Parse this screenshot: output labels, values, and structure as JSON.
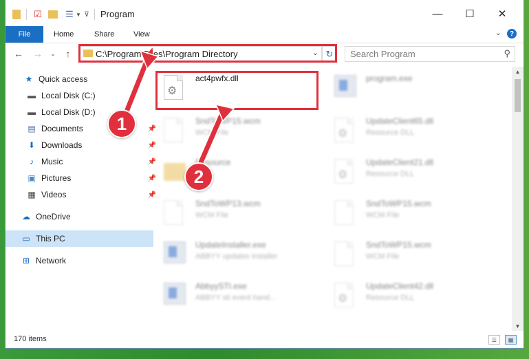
{
  "window": {
    "title": "Program",
    "controls": {
      "minimize": "—",
      "maximize": "☐",
      "close": "✕"
    }
  },
  "ribbon": {
    "tabs": [
      "File",
      "Home",
      "Share",
      "View"
    ],
    "help": "?"
  },
  "address": {
    "path": "C:\\Program Files\\Program Directory",
    "search_placeholder": "Search Program"
  },
  "nav": {
    "items": [
      {
        "label": "Quick access",
        "icon": "star-icon",
        "pinned": false
      },
      {
        "label": "Local Disk (C:)",
        "icon": "drive-icon",
        "pinned": false
      },
      {
        "label": "Local Disk (D:)",
        "icon": "drive-icon",
        "pinned": false
      },
      {
        "label": "Documents",
        "icon": "documents-icon",
        "pinned": true
      },
      {
        "label": "Downloads",
        "icon": "download-icon",
        "pinned": true
      },
      {
        "label": "Music",
        "icon": "music-icon",
        "pinned": true
      },
      {
        "label": "Pictures",
        "icon": "pictures-icon",
        "pinned": true
      },
      {
        "label": "Videos",
        "icon": "videos-icon",
        "pinned": true
      },
      {
        "label": "OneDrive",
        "icon": "cloud-icon",
        "pinned": false
      },
      {
        "label": "This PC",
        "icon": "computer-icon",
        "pinned": false,
        "selected": true
      },
      {
        "label": "Network",
        "icon": "network-icon",
        "pinned": false
      }
    ]
  },
  "files": [
    {
      "name": "act4pwfx.dll",
      "type": "",
      "icon": "dll-gear-icon",
      "highlighted": true
    },
    {
      "name": "program.exe",
      "type": "",
      "icon": "app-icon",
      "blurred": true
    },
    {
      "name": "SndToWP15.wcm",
      "type": "WCM File",
      "icon": "document-icon",
      "blurred": true
    },
    {
      "name": "UpdateClient65.dll",
      "type": "Resource DLL",
      "icon": "dll-gear-icon",
      "blurred": true
    },
    {
      "name": "Resource",
      "type": "",
      "icon": "folder-icon",
      "blurred": true
    },
    {
      "name": "UpdateClient21.dll",
      "type": "Resource DLL",
      "icon": "dll-gear-icon",
      "blurred": true
    },
    {
      "name": "SndToWP13.wcm",
      "type": "WCM File",
      "icon": "document-icon",
      "blurred": true
    },
    {
      "name": "SndToWP15.wcm",
      "type": "WCM File",
      "icon": "document-icon",
      "blurred": true
    },
    {
      "name": "UpdateInstaller.exe",
      "type": "ABBYY updates installer",
      "icon": "app-icon",
      "blurred": true
    },
    {
      "name": "SndToWP15.wcm",
      "type": "WCM File",
      "icon": "document-icon",
      "blurred": true
    },
    {
      "name": "AbbyySTI.exe",
      "type": "ABBYY sti event hand...",
      "icon": "app-icon",
      "blurred": true
    },
    {
      "name": "UpdateClient42.dll",
      "type": "Resource DLL",
      "icon": "dll-gear-icon",
      "blurred": true
    }
  ],
  "status": {
    "count": "170 items"
  },
  "callouts": [
    "1",
    "2"
  ],
  "colors": {
    "accent": "#1a6fc4",
    "highlight": "#e0303d",
    "selection": "#cde3f7"
  }
}
